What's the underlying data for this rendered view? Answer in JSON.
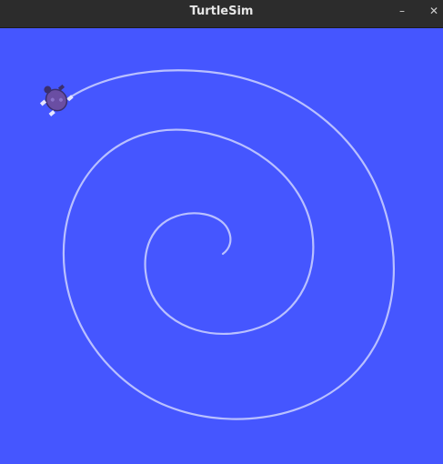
{
  "window": {
    "title": "TurtleSim",
    "minimize_glyph": "–",
    "close_glyph": "✕"
  },
  "canvas": {
    "background": "#4556ff",
    "trail_color": "#b9c0ff",
    "turtle_body_color": "#6a4ea3"
  },
  "icons": {
    "minimize": "minimize-icon",
    "close": "close-icon",
    "turtle": "turtle-icon"
  }
}
